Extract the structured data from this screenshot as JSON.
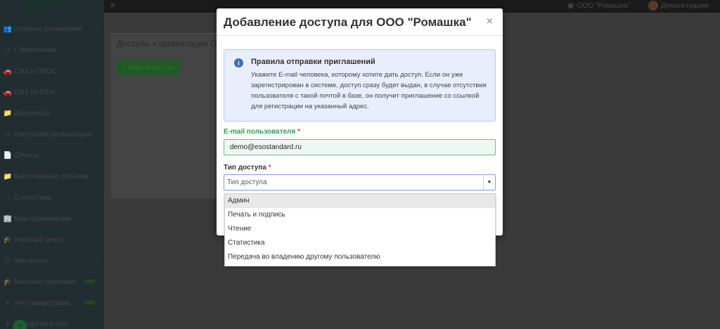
{
  "logo": {
    "line1": "ecostandard",
    "line2": "soft"
  },
  "sidebar": {
    "items": [
      {
        "label": "Штатное расписание",
        "icon": "users-icon",
        "glyph": "👥",
        "chevron": true
      },
      {
        "label": "Справочники",
        "icon": "list-icon",
        "glyph": "☰",
        "chevron": true
      },
      {
        "label": "СИЗ и СИОС",
        "icon": "car-icon",
        "glyph": "🚗",
        "chevron": true
      },
      {
        "label": "СИЗ по ЕТН",
        "icon": "car-icon",
        "glyph": "🚗",
        "chevron": true
      },
      {
        "label": "Документы",
        "icon": "folder-icon",
        "glyph": "📁",
        "chevron": true
      },
      {
        "label": "Настройки организации",
        "icon": "gear-icon",
        "glyph": "⚙",
        "chevron": false
      },
      {
        "label": "Отчеты",
        "icon": "file-icon",
        "glyph": "📄",
        "chevron": false
      },
      {
        "label": "Внеплановые события",
        "icon": "folder-icon",
        "glyph": "📁",
        "chevron": true
      },
      {
        "label": "Статистика",
        "icon": "pie-chart-icon",
        "glyph": "◔",
        "chevron": false
      },
      {
        "label": "Мои организации",
        "icon": "building-icon",
        "glyph": "🏢",
        "chevron": false
      },
      {
        "label": "Учебный центр",
        "icon": "graduation-cap-icon",
        "glyph": "🎓",
        "chevron": true
      },
      {
        "label": "Чек-листы",
        "icon": "checklist-icon",
        "glyph": "☰",
        "chevron": true
      },
      {
        "label": "Внешние обучения",
        "icon": "graduation-cap-icon",
        "glyph": "🎓",
        "badge": "new"
      },
      {
        "label": "Учет микротравм",
        "icon": "heart-icon",
        "glyph": "♥",
        "badge": "new"
      },
      {
        "label": "Импорт из Excel",
        "icon": "import-icon",
        "glyph": "⬆",
        "chevron": false
      }
    ],
    "help_label": "?"
  },
  "topbar": {
    "org_name": "ООО \"Ромашка\"",
    "user_name": "Демонстрация"
  },
  "page": {
    "title": "Доступы к организации О",
    "new_access_button": "+ Новый доступ"
  },
  "modal": {
    "title": "Добавление доступа для ООО \"Ромашка\"",
    "close_label": "×",
    "info": {
      "title": "Правила отправки приглашений",
      "text": "Укажите E-mail человека, которому хотите дать доступ. Если он уже зарегистрирован в системе, доступ сразу будет выдан, в случае отсутствия пользователя с такой почтой в базе, он получит приглашение со ссылкой для регистрации на указанный адрес."
    },
    "email_label": "E-mail пользователя",
    "email_value": "demo@esostandard.ru",
    "type_label": "Тип доступа",
    "required_mark": "*",
    "type_placeholder": "Тип доступа",
    "type_options": [
      "Админ",
      "Печать и подпись",
      "Чтение",
      "Статистика",
      "Передача во владению другому пользователю"
    ]
  }
}
